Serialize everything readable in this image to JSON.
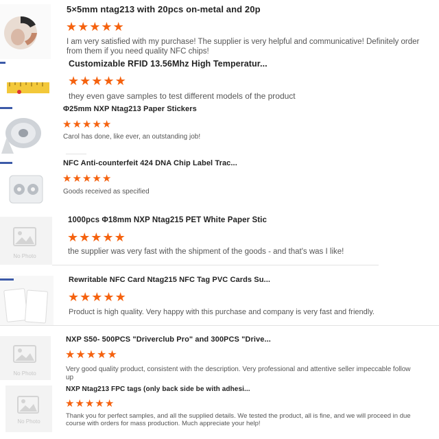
{
  "star_color": "#f5620f",
  "placeholder_text": "No Photo",
  "reviews": [
    {
      "title": "5×5mm ntag213 with 20pcs on-metal and 20p",
      "stars": [
        "★",
        "★",
        "★",
        "★",
        "★"
      ],
      "comment": "I am very satisfied with my purchase! The supplier is very helpful and communicative! Definitely order from them if you need quality NFC chips!"
    },
    {
      "title": "Customizable RFID 13.56Mhz High Temperatur...",
      "stars": [
        "★",
        "★",
        "★",
        "★",
        "★"
      ],
      "comment": "they even gave samples to test different models of the product"
    },
    {
      "title": "Φ25mm NXP Ntag213 Paper Stickers",
      "stars": [
        "★",
        "★",
        "★",
        "★",
        "★"
      ],
      "comment": "Carol has done, like ever, an outstanding job!"
    },
    {
      "title": "NFC Anti-counterfeit 424 DNA Chip Label Trac...",
      "stars": [
        "★",
        "★",
        "★",
        "★",
        "★"
      ],
      "comment": "Goods received as specified"
    },
    {
      "title": "1000pcs Φ18mm NXP Ntag215 PET White Paper Stic",
      "stars": [
        "★",
        "★",
        "★",
        "★",
        "★"
      ],
      "comment": "the supplier was very fast with the shipment of the goods - and that's was I like!"
    },
    {
      "title": "Rewritable NFC Card Ntag215 NFC Tag PVC Cards Su...",
      "stars": [
        "★",
        "★",
        "★",
        "★",
        "★"
      ],
      "comment": "Product is high quality. Very happy with this purchase and company is very fast and friendly."
    },
    {
      "title": "NXP S50- 500PCS \"Driverclub Pro\" and 300PCS \"Drive...",
      "stars": [
        "★",
        "★",
        "★",
        "★",
        "★"
      ],
      "comment": "Very good quality product, consistent with the description. Very professional and attentive seller impeccable follow up"
    },
    {
      "title": "NXP Ntag213 FPC tags (only back side be with adhesi...",
      "stars": [
        "★",
        "★",
        "★",
        "★",
        "★"
      ],
      "comment": "Thank you for perfect samples, and all the supplied details. We tested the product, all is fine, and we will proceed in due course with orders for mass production. Much appreciate your help!"
    }
  ]
}
